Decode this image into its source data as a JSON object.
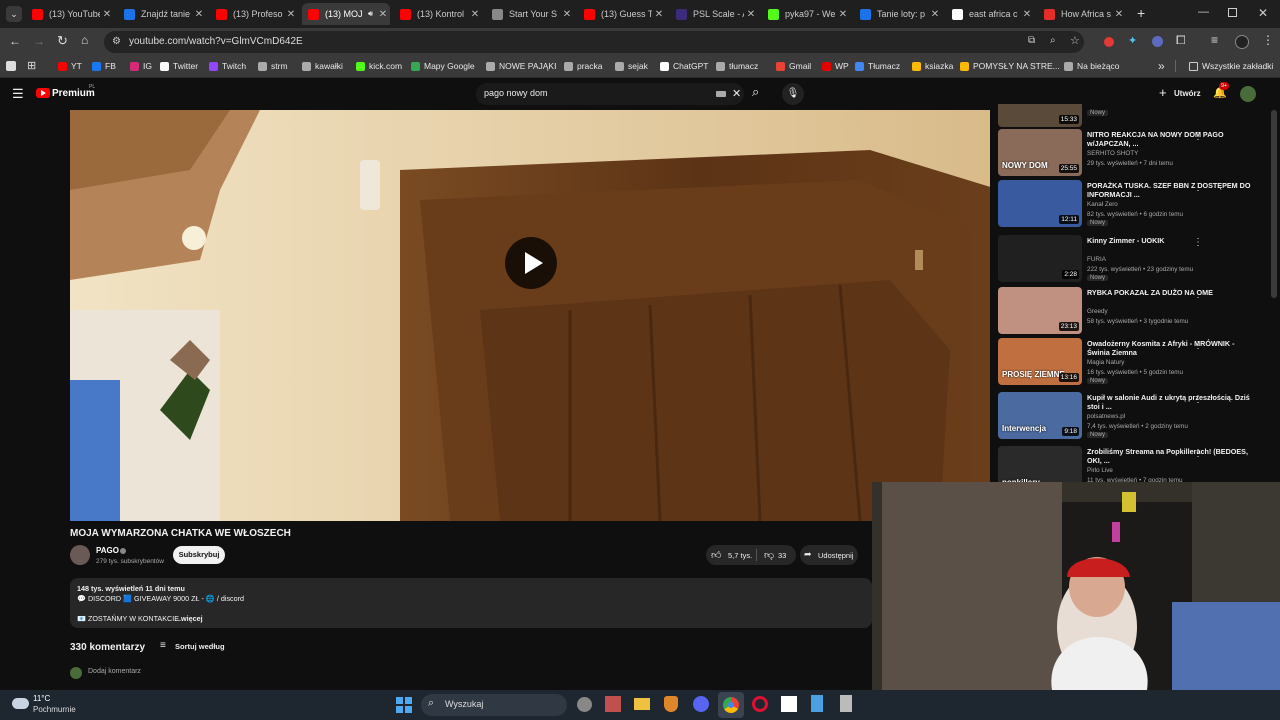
{
  "browser": {
    "tabs": [
      {
        "title": "(13) YouTube",
        "color": "#ff0000"
      },
      {
        "title": "Znajdź tanie",
        "color": "#1a73e8"
      },
      {
        "title": "(13) Profeso",
        "color": "#ff0000"
      },
      {
        "title": "(13) MOJ",
        "color": "#ff0000",
        "active": true
      },
      {
        "title": "(13) Kontrol",
        "color": "#ff0000"
      },
      {
        "title": "Start Your S",
        "color": "#888888"
      },
      {
        "title": "(13) Guess T",
        "color": "#ff0000"
      },
      {
        "title": "PSL Scale - A",
        "color": "#3b2b7a"
      },
      {
        "title": "pyka97 - We",
        "color": "#53fc18"
      },
      {
        "title": "Tanie loty: p",
        "color": "#1a73e8"
      },
      {
        "title": "east africa c",
        "color": "#ffffff"
      },
      {
        "title": "How Africa s",
        "color": "#e52d27"
      }
    ],
    "new_tab": "+",
    "url": "youtube.com/watch?v=GlmVCmD642E",
    "bookmarks": [
      {
        "label": "YT",
        "color": "#ff0000"
      },
      {
        "label": "FB",
        "color": "#1877f2"
      },
      {
        "label": "IG",
        "color": "#d62976"
      },
      {
        "label": "Twitter",
        "color": "#ffffff"
      },
      {
        "label": "Twitch",
        "color": "#9146ff"
      },
      {
        "label": "strm",
        "color": "#aaaaaa"
      },
      {
        "label": "kawałki",
        "color": "#aaaaaa"
      },
      {
        "label": "kick.com",
        "color": "#53fc18"
      },
      {
        "label": "Mapy Google",
        "color": "#34a853"
      },
      {
        "label": "NOWE PAJĄKI",
        "color": "#aaaaaa"
      },
      {
        "label": "pracka",
        "color": "#aaaaaa"
      },
      {
        "label": "sejak",
        "color": "#aaaaaa"
      },
      {
        "label": "ChatGPT",
        "color": "#ffffff"
      },
      {
        "label": "tłumacz",
        "color": "#aaaaaa"
      },
      {
        "label": "Gmail",
        "color": "#ea4335"
      },
      {
        "label": "WP",
        "color": "#e60000"
      },
      {
        "label": "Tłumacz",
        "color": "#4285f4"
      },
      {
        "label": "ksiazka",
        "color": "#ffbb00"
      },
      {
        "label": "POMYSŁY NA STRE...",
        "color": "#ffbb00"
      },
      {
        "label": "Na bieżąco",
        "color": "#aaaaaa"
      }
    ],
    "bookmarks_more": "»",
    "all_bookmarks": "Wszystkie zakładki"
  },
  "youtube": {
    "logo": "Premium",
    "logo_region": "PL",
    "search_value": "pago nowy dom",
    "create_label": "Utwórz",
    "notif_count": "9+",
    "video": {
      "title": "MOJA WYMARZONA CHATKA WE WŁOSZECH",
      "channel": "PAGO",
      "subscribers": "279 tys. subskrybentów",
      "subscribe": "Subskrybuj",
      "likes": "5,7 tys.",
      "dislikes": "33",
      "share": "Udostępnij",
      "views_date": "148 tys. wyświetleń  11 dni temu",
      "desc_line1": "💬 DISCORD 🟦 GIVEAWAY 9000 ZŁ - 🌐 / discord",
      "desc_line2": "📧 ZOSTAŃMY W KONTAKCIE",
      "more": "...więcej",
      "comments_count": "330 komentarzy",
      "sort": "Sortuj według",
      "add_comment": "Dodaj komentarz"
    },
    "recommendations": [
      {
        "title": "",
        "channel": "",
        "stats": "",
        "badge": "Nowy",
        "duration": "15:33",
        "partial": true
      },
      {
        "title": "NITRO REAKCJA NA NOWY DOM PAGO w/JAPCZAN, ...",
        "channel": "SERHITO SHOTY",
        "stats": "29 tys. wyświetleń • 7 dni temu",
        "badge": "",
        "duration": "25:55",
        "thumb_text": "NOWY DOM"
      },
      {
        "title": "PORAŻKA TUSKA. SZEF BBN Z DOSTĘPEM DO INFORMACJI ...",
        "channel": "Kanał Zero",
        "stats": "82 tys. wyświetleń • 6 godzin temu",
        "badge": "Nowy",
        "duration": "12:11"
      },
      {
        "title": "Kinny Zimmer - UOKIK",
        "channel": "FURIA",
        "stats": "222 tys. wyświetleń • 23 godziny temu",
        "badge": "Nowy",
        "duration": "2:28"
      },
      {
        "title": "RYBKA POKAZAŁ ZA DUŻO NA OME",
        "channel": "Greedy",
        "stats": "58 tys. wyświetleń • 3 tygodnie temu",
        "badge": "",
        "duration": "23:13"
      },
      {
        "title": "Owadożerny Kosmita z Afryki - MRÓWNIK - Świnia Ziemna",
        "channel": "Magia Natury",
        "stats": "16 tys. wyświetleń • 5 godzin temu",
        "badge": "Nowy",
        "duration": "13:16",
        "thumb_text": "PROSIĘ ZIEMNE"
      },
      {
        "title": "Kupił w salonie Audi z ukrytą przeszłością. Dziś stoi i ...",
        "channel": "polsatnews.pl",
        "stats": "7,4 tys. wyświetleń • 2 godziny temu",
        "badge": "Nowy",
        "duration": "9:18",
        "thumb_text": "Interwencja"
      },
      {
        "title": "Zrobiliśmy Streama na Popkillerach! (BEDOES, OKI, ...",
        "channel": "Pirlo Live",
        "stats": "11 tys. wyświetleń • 7 godzin temu",
        "badge": "",
        "duration": "",
        "thumb_text": "popkillery"
      }
    ]
  },
  "taskbar": {
    "temp": "11°C",
    "weather": "Pochmurnie",
    "search_placeholder": "Wyszukaj"
  }
}
